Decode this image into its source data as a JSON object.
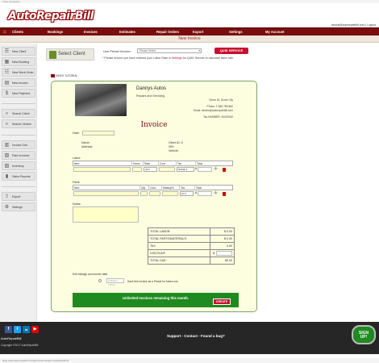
{
  "top_strip": "Order Snapshot",
  "header": {
    "logo": "AutoRepairBill",
    "user_email": "dennis@autorepairbill.com",
    "logout": "Logout"
  },
  "nav": [
    "Clients",
    "Bookings",
    "Invoices",
    "Estimates",
    "Repair Orders",
    "Export",
    "Settings",
    "My Account"
  ],
  "page_title": "New Invoice",
  "sidebar": [
    {
      "label": "New Client",
      "icon": "new-client-icon"
    },
    {
      "label": "New Booking",
      "icon": "calendar-icon"
    },
    {
      "label": "New Work Order",
      "icon": "work-order-icon"
    },
    {
      "label": "New Invoice",
      "icon": "invoice-icon"
    },
    {
      "label": "New Payment",
      "icon": "payment-icon"
    },
    {
      "label": "Search Client",
      "icon": "search-icon"
    },
    {
      "label": "Search Vehicle",
      "icon": "search-icon"
    },
    {
      "label": "Invoice Due",
      "icon": "due-icon"
    },
    {
      "label": "Paid Invoices",
      "icon": "paid-icon"
    },
    {
      "label": "Inventory",
      "icon": "inventory-icon"
    },
    {
      "label": "Sales Reports",
      "icon": "chart-icon"
    },
    {
      "label": "Export",
      "icon": "export-icon"
    },
    {
      "label": "Settings",
      "icon": "gear-icon"
    }
  ],
  "select_client": "Select Client",
  "preset": {
    "label": "Use Preset Invoice:",
    "placeholder": "Please Select"
  },
  "quik_button": "QUIK SERVICE",
  "quik_note": {
    "pre": "* Please ensure you have entered your Labor Rate in ",
    "link": "Settings",
    "post": " for QUIK Service to calculate labor rate."
  },
  "video_tutorial": "VIDEO TUTORIAL",
  "business": {
    "name": "Dannys Autos",
    "sub": "Repairs and Servicing",
    "address": "Some St, Some City",
    "phone": "Phone: 1 555 789 852",
    "email": "Email: dennis@autorepairbill.com",
    "tax": "Tax NUMBER: 43423340"
  },
  "invoice_title": "Invoice",
  "fields": {
    "date": "Date:",
    "name": "Name:",
    "address": "Address:",
    "client_id": "Client ID: 0",
    "vin": "VIN:",
    "vehicle": "Vehicle:"
  },
  "labor": {
    "section": "Labor:",
    "headers": [
      "Item",
      "Hours",
      "Rate",
      "Cost",
      "Tax",
      "Total"
    ],
    "rate": "40",
    "tax": "NONE",
    "total": "$"
  },
  "parts": {
    "section": "Parts:",
    "headers": [
      "Item",
      "Qty",
      "Cost",
      "Markup%",
      "Tax",
      "Total"
    ],
    "tax": "10",
    "total": "$"
  },
  "notes_label": "Notes:",
  "totals": [
    {
      "label": "TOTAL LABOR:",
      "value": "$ 0.00"
    },
    {
      "label": "TOTAL PARTS/MATERIALS:",
      "value": "$ 0.00"
    },
    {
      "label": "TAX",
      "value": "0.00"
    },
    {
      "label": "DISCOUNT:",
      "value": "$"
    },
    {
      "label": "TOTAL DUE:",
      "value": "$0.00"
    }
  ],
  "mileage": "Edit mileage and service date",
  "preset_title_placeholder": "PRESET TITLE",
  "preset_save_note": "Save this invoice as a Preset for future use",
  "unlimited": "Unlimited Invoices remaining this month.",
  "create_button": "CREATE",
  "footer": {
    "links": "Support - Contact - Found a bug?",
    "brand": "AutoRepairBill",
    "copyright": "Copyright ©2017 AutoRepairBill",
    "signup": [
      "SIGN",
      "UP!"
    ]
  },
  "statusbar": "https://www.autorepairbill.com/app/invoice?action=new&clientID=0"
}
